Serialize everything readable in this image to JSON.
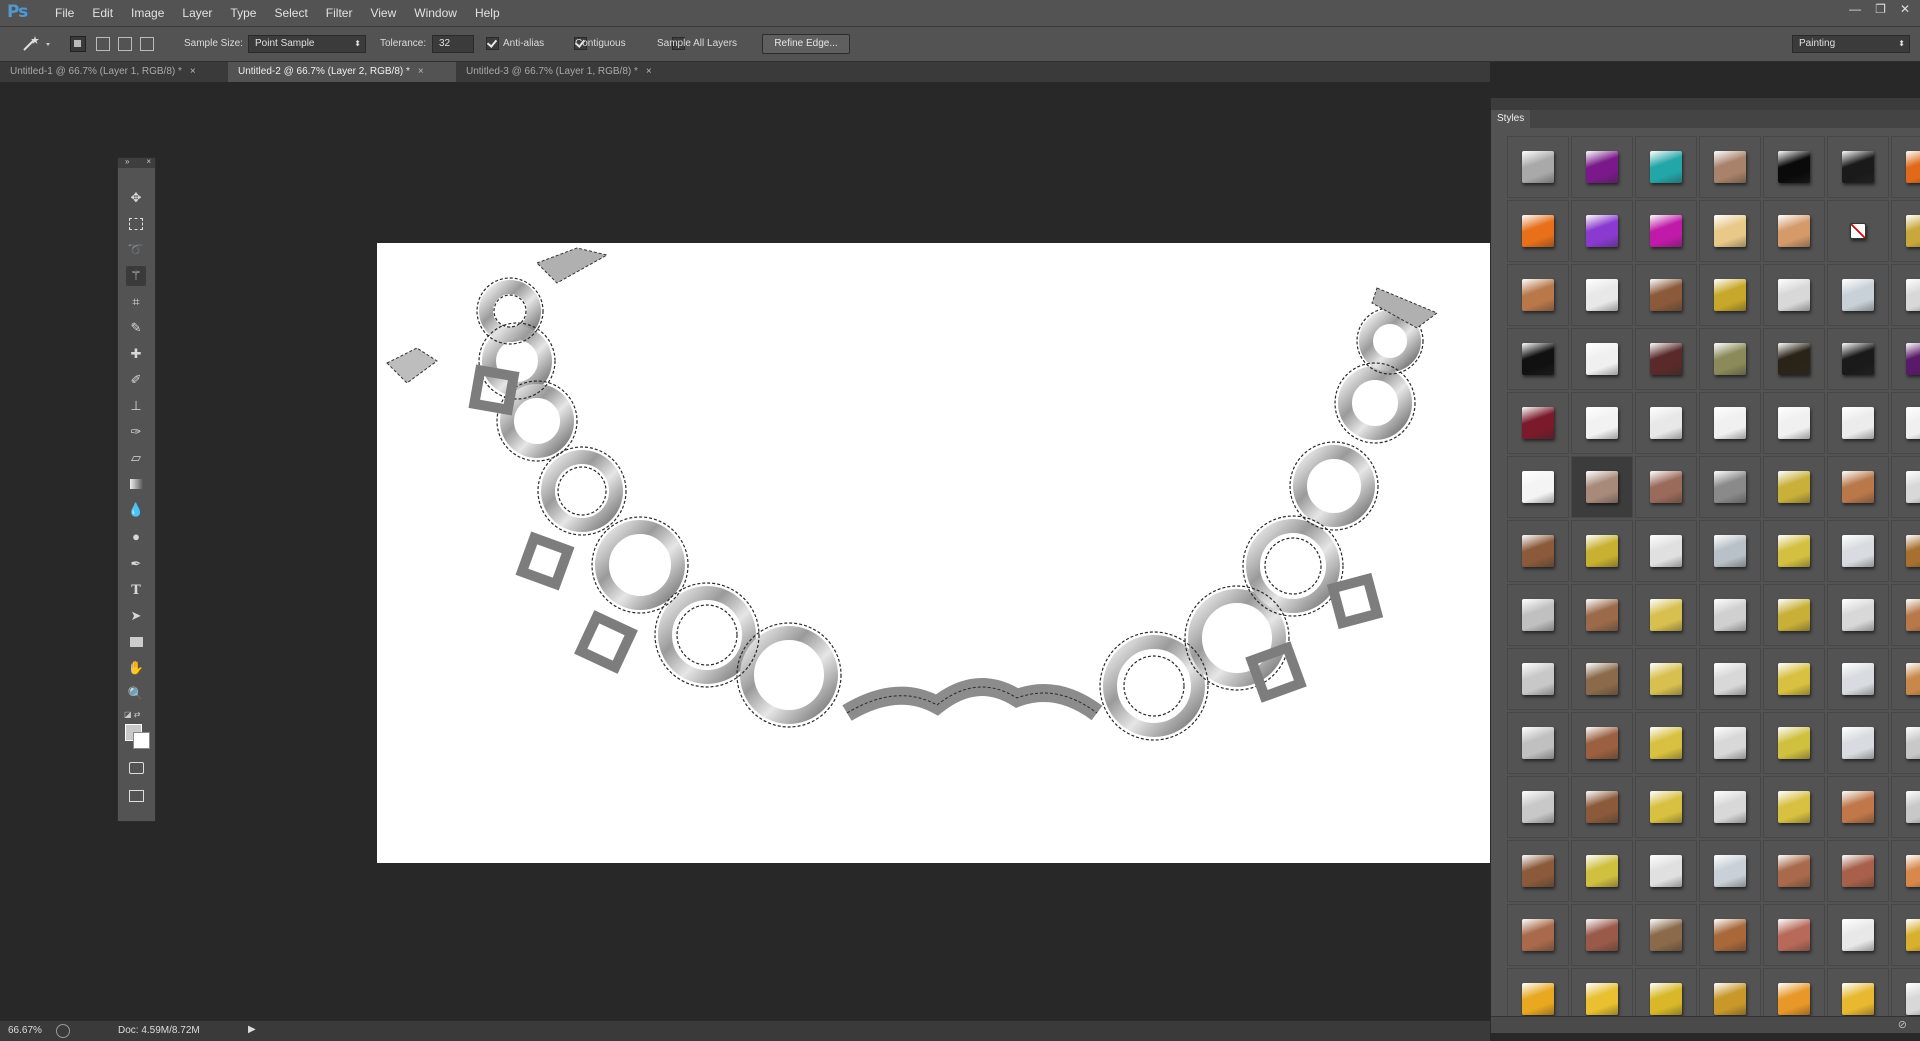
{
  "app": {
    "logo": "Ps"
  },
  "menu": {
    "items": [
      "File",
      "Edit",
      "Image",
      "Layer",
      "Type",
      "Select",
      "Filter",
      "View",
      "Window",
      "Help"
    ]
  },
  "window_controls": {
    "minimize": "—",
    "restore": "❐",
    "close": "✕"
  },
  "options": {
    "sample_size_label": "Sample Size:",
    "sample_size_value": "Point Sample",
    "tolerance_label": "Tolerance:",
    "tolerance_value": "32",
    "anti_alias_label": "Anti-alias",
    "anti_alias_checked": true,
    "contiguous_label": "Contiguous",
    "contiguous_checked": true,
    "sample_all_layers_label": "Sample All Layers",
    "sample_all_layers_checked": false,
    "refine_edge_label": "Refine Edge...",
    "workspace_value": "Painting"
  },
  "tabs": [
    {
      "label": "Untitled-1 @ 66.7% (Layer 1, RGB/8) *",
      "active": false
    },
    {
      "label": "Untitled-2 @ 66.7% (Layer 2, RGB/8) *",
      "active": true
    },
    {
      "label": "Untitled-3 @ 66.7% (Layer 1, RGB/8) *",
      "active": false
    }
  ],
  "tools": [
    "move-tool",
    "marquee-tool",
    "lasso-tool",
    "magic-wand-tool",
    "crop-tool",
    "eyedropper-tool",
    "healing-brush-tool",
    "brush-tool",
    "clone-stamp-tool",
    "history-brush-tool",
    "eraser-tool",
    "gradient-tool",
    "blur-tool",
    "dodge-tool",
    "pen-tool",
    "type-tool",
    "path-selection-tool",
    "rectangle-tool",
    "hand-tool",
    "zoom-tool"
  ],
  "styles_panel": {
    "title": "Styles",
    "colors": {
      "swatches": [
        [
          "#a9a9a9",
          "#7a1a8a",
          "#23a6a8",
          "#a8826a",
          "#0a0a0a",
          "#1a1a1a",
          "#e06a1a"
        ],
        [
          "#e8701a",
          "#8a3ad0",
          "#c01aa8",
          "#e9c98a",
          "#d49a6a",
          "none",
          "#c8a83a"
        ],
        [
          "#b8784a",
          "#e8e8e8",
          "#8a5a3a",
          "#c8a82a",
          "#d8d8d8",
          "#c8d0d8",
          "#d8d8d8"
        ],
        [
          "#111111",
          "#f0f0f0",
          "#5a2a2a",
          "#8a8a5a",
          "#2a2418",
          "#1a1a1a",
          "#5a1a6a"
        ],
        [
          "#7a1a2a",
          "#f2f2f2",
          "#e8e8e8",
          "#f0f0f0",
          "#f0f0f0",
          "#ececec",
          "#f0f0f0"
        ],
        [
          "#f4f4f4",
          "#a88a7a",
          "#9a6a5a",
          "#8a8a8a",
          "#c8b03a",
          "#b8784a",
          "#d8d8d8"
        ],
        [
          "#8a5a3a",
          "#c8b030",
          "#e0e0e0",
          "#b8c0c8",
          "#d4c040",
          "#d8dce0",
          "#a87030"
        ],
        [
          "#c0c0c0",
          "#9a6a4a",
          "#d8c050",
          "#d0d0d0",
          "#c8b038",
          "#d8d8d8",
          "#b8784a"
        ],
        [
          "#c8c8c8",
          "#8a6a4a",
          "#d8c050",
          "#d8d8d8",
          "#d8c040",
          "#d8dce0",
          "#c8884a"
        ],
        [
          "#c0c0c0",
          "#9a6040",
          "#d8c040",
          "#d8d8d8",
          "#d0c040",
          "#d8dce0",
          "#c8c8c8"
        ],
        [
          "#c8c8c8",
          "#8a5a3a",
          "#d8c040",
          "#d8d8d8",
          "#d8c040",
          "#c0784a",
          "#c8c8c8"
        ],
        [
          "#8a5a3a",
          "#d0c040",
          "#e0e0e0",
          "#c8d0d8",
          "#a86a4a",
          "#a8604a",
          "#d8884a"
        ],
        [
          "#a86a4a",
          "#9a5a4a",
          "#8a6a4a",
          "#a8683a",
          "#b86a5a",
          "#e8e8e8",
          "#d8b030"
        ],
        [
          "#e8a820",
          "#e8c030",
          "#d8b828",
          "#c8982a",
          "#e89828",
          "#e8b830",
          "#d8d8d8"
        ]
      ],
      "selected_swatch": "5,1"
    }
  },
  "status": {
    "zoom": "66.67%",
    "doc": "Doc: 4.59M/8.72M"
  }
}
